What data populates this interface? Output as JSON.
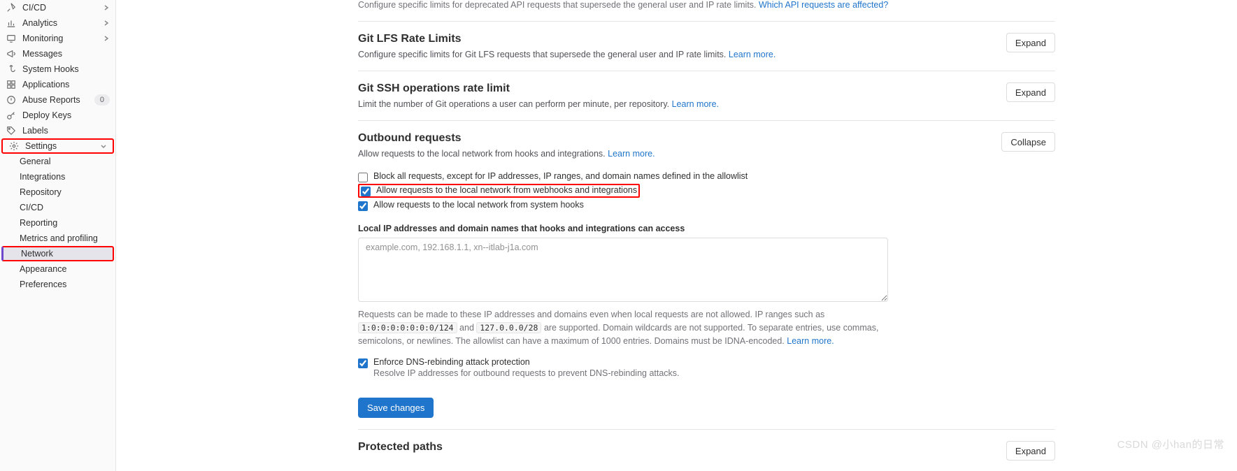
{
  "sidebar": {
    "items": [
      {
        "label": "CI/CD",
        "icon": "rocket-icon",
        "expandable": true
      },
      {
        "label": "Analytics",
        "icon": "chart-icon",
        "expandable": true
      },
      {
        "label": "Monitoring",
        "icon": "monitor-icon",
        "expandable": true
      },
      {
        "label": "Messages",
        "icon": "megaphone-icon"
      },
      {
        "label": "System Hooks",
        "icon": "hook-icon"
      },
      {
        "label": "Applications",
        "icon": "applications-icon"
      },
      {
        "label": "Abuse Reports",
        "icon": "abuse-icon",
        "badge": "0"
      },
      {
        "label": "Deploy Keys",
        "icon": "key-icon"
      },
      {
        "label": "Labels",
        "icon": "label-icon"
      },
      {
        "label": "Settings",
        "icon": "settings-icon",
        "expandable": true,
        "highlight": true
      }
    ],
    "subitems": [
      {
        "label": "General"
      },
      {
        "label": "Integrations"
      },
      {
        "label": "Repository"
      },
      {
        "label": "CI/CD"
      },
      {
        "label": "Reporting"
      },
      {
        "label": "Metrics and profiling"
      },
      {
        "label": "Network",
        "active": true,
        "highlight": true
      },
      {
        "label": "Appearance"
      },
      {
        "label": "Preferences"
      }
    ]
  },
  "content": {
    "truncated": {
      "desc": "Configure specific limits for deprecated API requests that supersede the general user and IP rate limits.",
      "link": "Which API requests are affected?"
    },
    "sections": {
      "lfs": {
        "title": "Git LFS Rate Limits",
        "expand": "Expand",
        "desc": "Configure specific limits for Git LFS requests that supersede the general user and IP rate limits.",
        "learn": "Learn more."
      },
      "ssh": {
        "title": "Git SSH operations rate limit",
        "expand": "Expand",
        "desc": "Limit the number of Git operations a user can perform per minute, per repository.",
        "learn": "Learn more."
      },
      "outbound": {
        "title": "Outbound requests",
        "collapse": "Collapse",
        "desc": "Allow requests to the local network from hooks and integrations.",
        "learn": "Learn more.",
        "cb_block": "Block all requests, except for IP addresses, IP ranges, and domain names defined in the allowlist",
        "cb_webhooks": "Allow requests to the local network from webhooks and integrations",
        "cb_system": "Allow requests to the local network from system hooks",
        "field_label": "Local IP addresses and domain names that hooks and integrations can access",
        "placeholder": "example.com, 192.168.1.1, xn--itlab-j1a.com",
        "help1": "Requests can be made to these IP addresses and domains even when local requests are not allowed. IP ranges such as ",
        "code1": "1:0:0:0:0:0:0:0/124",
        "help2": " and ",
        "code2": "127.0.0.0/28",
        "help3": " are supported. Domain wildcards are not supported. To separate entries, use commas, semicolons, or newlines. The allowlist can have a maximum of 1000 entries. Domains must be IDNA-encoded.",
        "help_learn": "Learn more.",
        "cb_dns": "Enforce DNS-rebinding attack protection",
        "cb_dns_sub": "Resolve IP addresses for outbound requests to prevent DNS-rebinding attacks.",
        "save": "Save changes"
      },
      "protected": {
        "title": "Protected paths",
        "expand": "Expand"
      }
    }
  },
  "watermark": "CSDN @小han的日常"
}
